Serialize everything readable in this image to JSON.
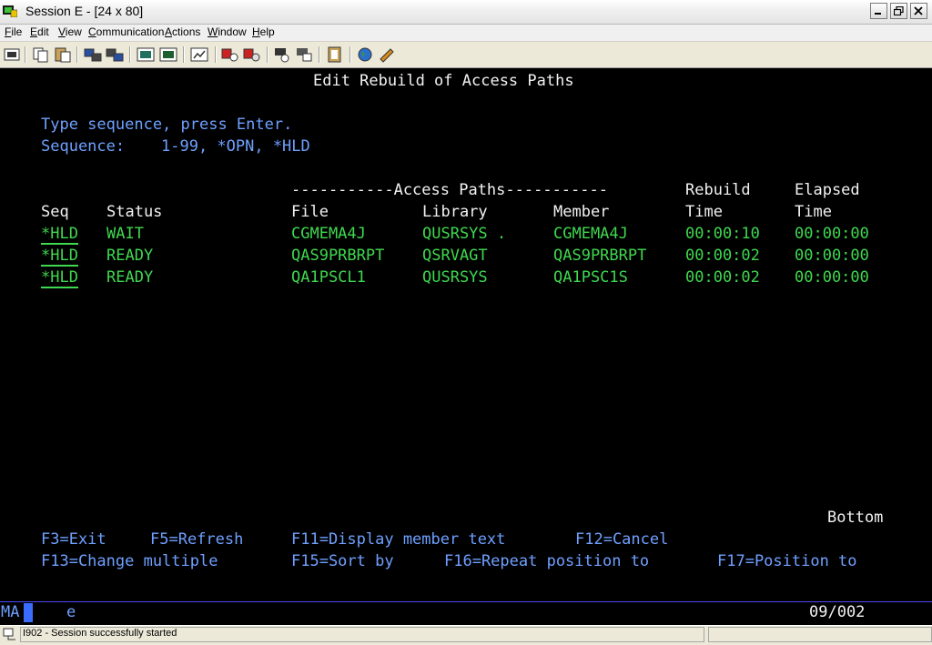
{
  "window": {
    "title": "Session E - [24 x 80]"
  },
  "menu": {
    "file": {
      "mnemonic": "F",
      "rest": "ile"
    },
    "edit": {
      "mnemonic": "E",
      "rest": "dit"
    },
    "view": {
      "mnemonic": "V",
      "rest": "iew"
    },
    "communication": {
      "mnemonic": "C",
      "rest": "ommunication"
    },
    "actions": {
      "mnemonic": "A",
      "rest": "ctions"
    },
    "window": {
      "mnemonic": "W",
      "rest": "indow"
    },
    "help": {
      "mnemonic": "H",
      "rest": "elp"
    }
  },
  "toolbar_icons": [
    "print-screen-icon",
    "copy-icon",
    "paste-icon",
    "send-icon",
    "receive-icon",
    "display-icon",
    "keypad-icon",
    "chart-icon",
    "macro-play-icon",
    "macro-record-icon",
    "macro-stop-icon",
    "macro-edit-icon",
    "clipboard-icon",
    "globe-icon",
    "help-icon"
  ],
  "screen": {
    "title": "Edit Rebuild of Access Paths",
    "instruction": "Type sequence, press Enter.",
    "sequence_label": "Sequence:",
    "sequence_values": "1-99, *OPN, *HLD",
    "group_header": "-----------Access Paths-----------",
    "headers": {
      "seq": "Seq",
      "status": "Status",
      "file": "File",
      "library": "Library",
      "member": "Member",
      "rebuild_top": "Rebuild",
      "rebuild_bottom": "Time",
      "elapsed_top": "Elapsed",
      "elapsed_bottom": "Time"
    },
    "rows": [
      {
        "seq": "*HLD",
        "status": "WAIT",
        "file": "CGMEMA4J",
        "library": "QUSRSYS .",
        "member": "CGMEMA4J",
        "rebuild": "00:00:10",
        "elapsed": "00:00:00"
      },
      {
        "seq": "*HLD",
        "status": "READY",
        "file": "QAS9PRBRPT",
        "library": "QSRVAGT",
        "member": "QAS9PRBRPT",
        "rebuild": "00:00:02",
        "elapsed": "00:00:00"
      },
      {
        "seq": "*HLD",
        "status": "READY",
        "file": "QA1PSCL1",
        "library": "QUSRSYS",
        "member": "QA1PSC1S",
        "rebuild": "00:00:02",
        "elapsed": "00:00:00"
      }
    ],
    "bottom_indicator": "Bottom",
    "function_keys": {
      "f3": "F3=Exit",
      "f5": "F5=Refresh",
      "f11": "F11=Display member text",
      "f12": "F12=Cancel",
      "f13": "F13=Change multiple",
      "f15": "F15=Sort by",
      "f16": "F16=Repeat position to",
      "f17": "F17=Position to"
    }
  },
  "oia": {
    "mode": "MA",
    "indicator": "e",
    "cursor_position": "09/002"
  },
  "status_bar": {
    "message": "I902 - Session successfully started"
  },
  "colors": {
    "background": "#000000",
    "title": "#f2f2f2",
    "field": "#6fa0ff",
    "data": "#3fd84f"
  }
}
